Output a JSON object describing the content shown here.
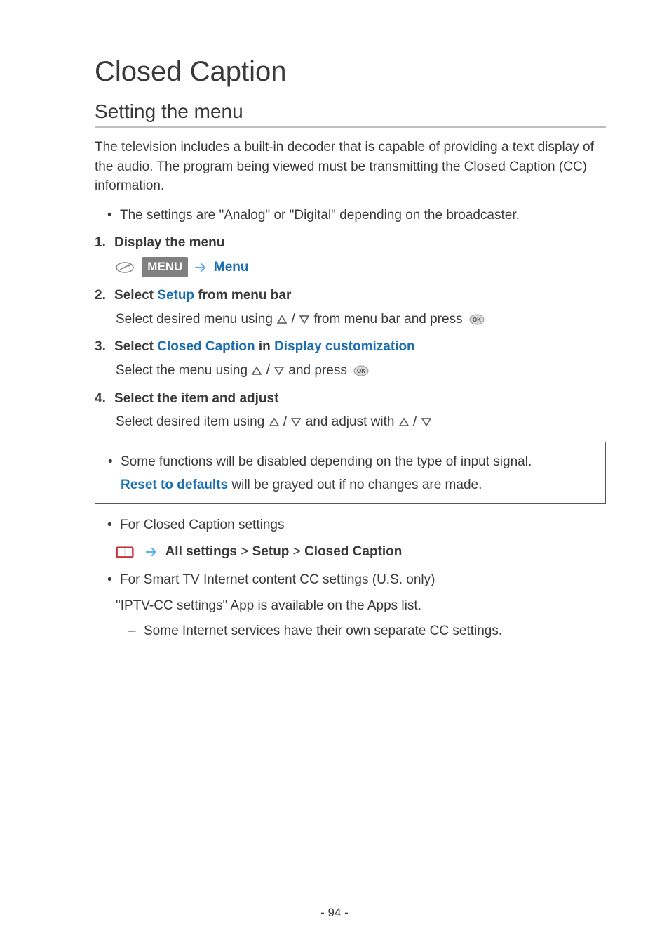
{
  "title": "Closed Caption",
  "section": "Setting the menu",
  "intro": "The television includes a built-in decoder that is capable of providing a text display of the audio. The program being viewed must be transmitting the Closed Caption (CC) information.",
  "bullet1": "The settings are \"Analog\" or \"Digital\" depending on the broadcaster.",
  "step1": {
    "num": "1.",
    "label": "Display the menu",
    "menu_chip": "MENU",
    "menu_link": "Menu"
  },
  "step2": {
    "num": "2.",
    "prefix": "Select ",
    "link": "Setup",
    "suffix": " from menu bar",
    "sub_a": "Select desired menu using ",
    "sub_b": " / ",
    "sub_c": " from menu bar and press "
  },
  "step3": {
    "num": "3.",
    "prefix": "Select ",
    "link1": "Closed Caption",
    "mid": " in ",
    "link2": "Display customization",
    "sub_a": "Select the menu using ",
    "sub_b": " / ",
    "sub_c": " and press "
  },
  "step4": {
    "num": "4.",
    "label": "Select the item and adjust",
    "sub_a": "Select desired item using ",
    "sub_b": " / ",
    "sub_c": " and adjust with ",
    "sub_d": " / "
  },
  "note": {
    "line1": "Some functions will be disabled depending on the type of input signal.",
    "link": "Reset to defaults",
    "line2_suffix": " will be grayed out if no changes are made."
  },
  "cc_settings_bullet": "For Closed Caption settings",
  "breadcrumb": {
    "a": "All settings",
    "sep": " > ",
    "b": "Setup",
    "c": "Closed Caption"
  },
  "smarttv_bullet": "For Smart TV Internet content CC settings (U.S. only)",
  "smarttv_sub": "\"IPTV-CC settings\" App is available on the Apps list.",
  "smarttv_dash": "Some Internet services have their own separate CC settings.",
  "page_number": "- 94 -"
}
